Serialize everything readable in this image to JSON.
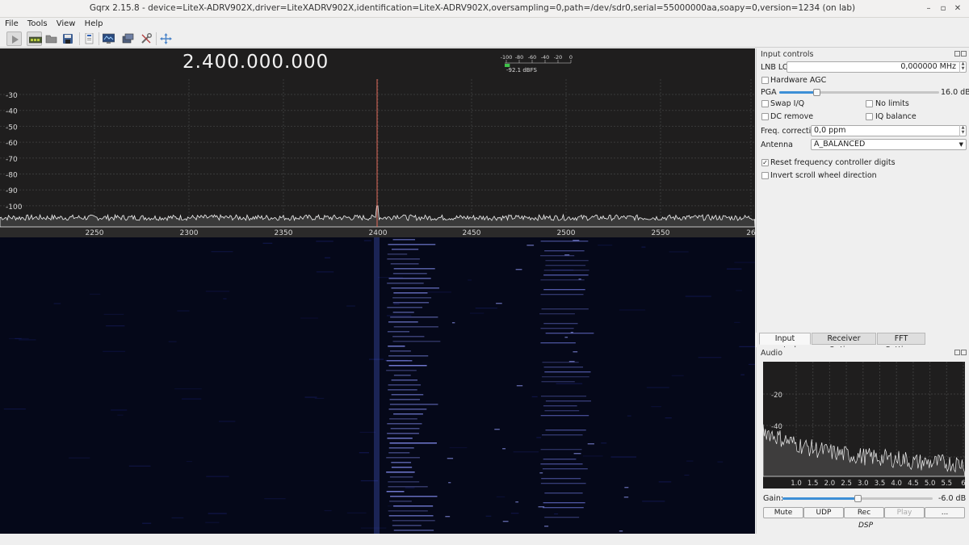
{
  "window": {
    "title": "Gqrx 2.15.8 - device=LiteX-ADRV902X,driver=LiteXADRV902X,identification=LiteX-ADRV902X,oversampling=0,path=/dev/sdr0,serial=55000000aa,soapy=0,version=1234 (on lab)",
    "min_glyph": "–",
    "max_glyph": "▫",
    "close_glyph": "✕"
  },
  "menu": [
    "File",
    "Tools",
    "View",
    "Help"
  ],
  "toolbar": {
    "icons": [
      "start-icon",
      "hardware-icon",
      "open-folder-icon",
      "save-icon",
      "remote-control-icon",
      "screenshot-icon",
      "device-icon",
      "settings-icon",
      "center-icon"
    ]
  },
  "plotter": {
    "frequency": "2.400.000.000",
    "db_ticks": [
      "-30",
      "-40",
      "-50",
      "-60",
      "-70",
      "-80",
      "-90",
      "-100"
    ],
    "freq_ticks": [
      "2250",
      "2300",
      "2350",
      "2400",
      "2450",
      "2500",
      "2550",
      "26"
    ],
    "meter_ticks": [
      "-100",
      "-80",
      "-60",
      "-40",
      "-20",
      "0"
    ],
    "meter_level_dbfs": -92.1,
    "meter_readout": "-92.1 dBFS",
    "colors": {
      "background": "#1f1e1e",
      "waterfall": "#050819",
      "marker": "#e3695b",
      "trace": "#f2f2f2",
      "meter": "#3fc24a"
    }
  },
  "input_controls": {
    "title": "Input controls",
    "lnb_lo": {
      "label": "LNB LO",
      "value": "0,000000 MHz"
    },
    "hardware_agc": {
      "label": "Hardware AGC",
      "checked": false
    },
    "pga": {
      "label": "PGA",
      "value": "16.0 dB",
      "fraction": 0.23
    },
    "swap_iq": {
      "label": "Swap I/Q",
      "checked": false
    },
    "no_limits": {
      "label": "No limits",
      "checked": false
    },
    "dc_remove": {
      "label": "DC remove",
      "checked": false
    },
    "iq_balance": {
      "label": "IQ balance",
      "checked": false
    },
    "freq_correction": {
      "label": "Freq. correction",
      "value": "0,0 ppm"
    },
    "antenna": {
      "label": "Antenna",
      "value": "A_BALANCED"
    },
    "reset_digits": {
      "label": "Reset frequency controller digits",
      "checked": true,
      "mark": "✓"
    },
    "invert_scroll": {
      "label": "Invert scroll wheel direction",
      "checked": false
    }
  },
  "tabs": [
    "Input controls",
    "Receiver Options",
    "FFT Settings"
  ],
  "audio": {
    "title": "Audio",
    "db_ticks": [
      "-20",
      "-40",
      "-60"
    ],
    "freq_ticks": [
      "1.0",
      "1.5",
      "2.0",
      "2.5",
      "3.0",
      "3.5",
      "4.0",
      "4.5",
      "5.0",
      "5.5",
      "6"
    ],
    "gain": {
      "label": "Gain:",
      "value": "-6.0 dB",
      "fraction": 0.5
    },
    "buttons": {
      "mute": "Mute",
      "udp": "UDP",
      "rec": "Rec",
      "play": "Play",
      "more": "..."
    },
    "footer": "DSP"
  }
}
